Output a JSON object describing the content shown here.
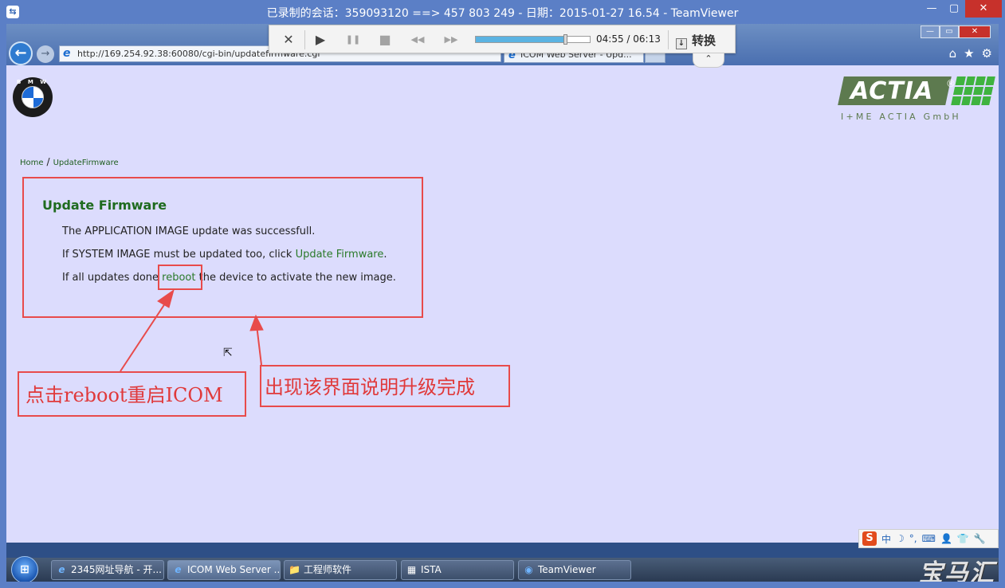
{
  "teamviewer": {
    "title": "已录制的会话：359093120 ==> 457 803 249 - 日期：2015-01-27 16.54 - TeamViewer",
    "minimize": "—",
    "maximize": "▢",
    "close": "✕",
    "player": {
      "stop_icon": "✕",
      "play_icon": "▶",
      "pause_icon": "❚❚",
      "stop_square_icon": "■",
      "rewind_icon": "◀◀",
      "forward_icon": "▶▶",
      "progress": 0.78,
      "time": "04:55 / 06:13",
      "convert_label": "转换",
      "collapse_icon": "⌃"
    }
  },
  "browser": {
    "address": "http://169.254.92.38:60080/cgi-bin/updatefirmware.cgi",
    "tab_title": "ICOM Web Server - Upd...",
    "back_icon": "←",
    "forward_icon": "→",
    "ie_icon": "e",
    "win_min": "—",
    "win_max": "▭",
    "win_close": "✕",
    "home_icon": "⌂",
    "favorites_icon": "★",
    "tools_icon": "⚙"
  },
  "page": {
    "bmw_text": "B M W",
    "actia": {
      "word": "ACTIA",
      "reg": "®",
      "subtitle": "I+ME ACTIA GmbH"
    },
    "breadcrumb": {
      "home": "Home",
      "separator": "/",
      "current": "UpdateFirmware"
    },
    "heading": "Update Firmware",
    "line1": "The APPLICATION IMAGE update was successfull.",
    "line2_prefix": "If SYSTEM IMAGE must be updated too, click ",
    "line2_link": "Update Firmware",
    "line2_suffix": ".",
    "line3_prefix": "If all updates done ",
    "line3_link": "reboot",
    "line3_suffix": " the device to activate the new image."
  },
  "annotations": {
    "left_note": "点击reboot重启ICOM",
    "right_note": "出现该界面说明升级完成",
    "color": "#e0393a"
  },
  "ime": {
    "logo": "S",
    "items": [
      "中",
      "☽",
      "°,",
      "⌨",
      "👤",
      "👕",
      "🔧"
    ]
  },
  "taskbar": {
    "start_icon": "⊞",
    "tasks": [
      {
        "label": "2345网址导航 - 开...",
        "icon": "e"
      },
      {
        "label": "ICOM Web Server ...",
        "icon": "e"
      },
      {
        "label": "工程师软件",
        "icon": "📁"
      },
      {
        "label": "ISTA",
        "icon": "▦"
      },
      {
        "label": "TeamViewer",
        "icon": "◉"
      }
    ],
    "watermark": "宝马汇"
  }
}
